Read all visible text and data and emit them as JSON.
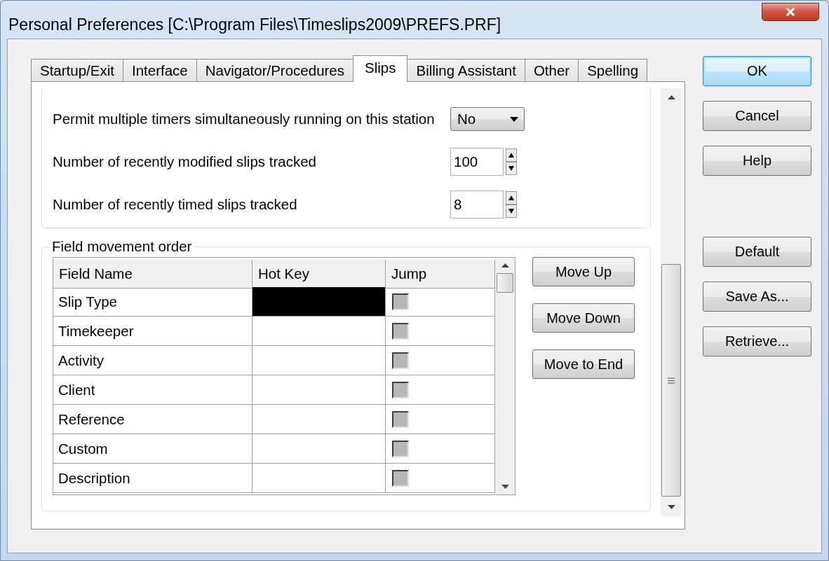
{
  "window": {
    "title": "Personal Preferences [C:\\Program Files\\Timeslips2009\\PREFS.PRF]"
  },
  "tabs": [
    {
      "label": "Startup/Exit",
      "selected": false
    },
    {
      "label": "Interface",
      "selected": false
    },
    {
      "label": "Navigator/Procedures",
      "selected": false
    },
    {
      "label": "Slips",
      "selected": true
    },
    {
      "label": "Billing Assistant",
      "selected": false
    },
    {
      "label": "Other",
      "selected": false
    },
    {
      "label": "Spelling",
      "selected": false
    }
  ],
  "settings": [
    {
      "kind": "dropdown",
      "label": "Permit multiple timers simultaneously running on this station",
      "value": "No"
    },
    {
      "kind": "spinner",
      "label": "Number of recently modified slips tracked",
      "value": "100"
    },
    {
      "kind": "spinner",
      "label": "Number of recently timed slips tracked",
      "value": "8"
    }
  ],
  "field_movement": {
    "title": "Field movement order",
    "columns": [
      "Field Name",
      "Hot Key",
      "Jump"
    ],
    "rows": [
      {
        "name": "Slip Type",
        "hotkey_selected": true,
        "jump_checked": false
      },
      {
        "name": "Timekeeper",
        "hotkey_selected": false,
        "jump_checked": false
      },
      {
        "name": "Activity",
        "hotkey_selected": false,
        "jump_checked": false
      },
      {
        "name": "Client",
        "hotkey_selected": false,
        "jump_checked": false
      },
      {
        "name": "Reference",
        "hotkey_selected": false,
        "jump_checked": false
      },
      {
        "name": "Custom",
        "hotkey_selected": false,
        "jump_checked": false
      },
      {
        "name": "Description",
        "hotkey_selected": false,
        "jump_checked": false
      }
    ],
    "buttons": [
      "Move Up",
      "Move Down",
      "Move to End"
    ]
  },
  "buttons_top": [
    {
      "label": "OK",
      "default": true
    },
    {
      "label": "Cancel",
      "default": false
    },
    {
      "label": "Help",
      "default": false
    }
  ],
  "buttons_bottom": [
    "Default",
    "Save As...",
    "Retrieve..."
  ]
}
